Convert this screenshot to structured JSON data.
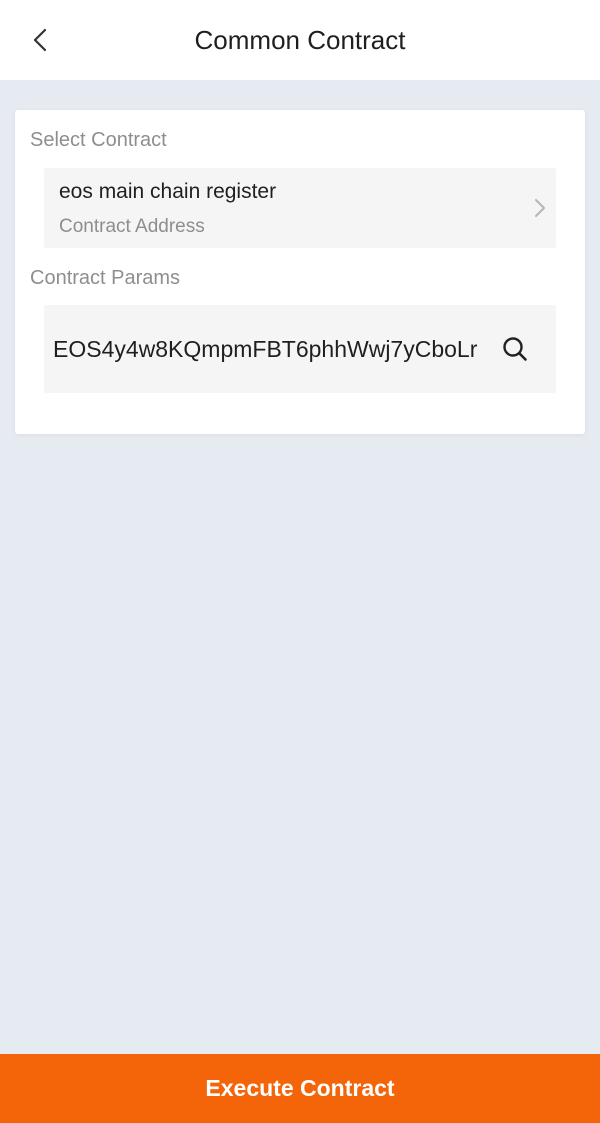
{
  "header": {
    "title": "Common Contract",
    "back_icon": "chevron-left-icon"
  },
  "select_contract": {
    "label": "Select Contract",
    "contract_name": "eos main chain register",
    "contract_address_placeholder": "Contract Address",
    "chevron_icon": "chevron-right-icon"
  },
  "contract_params": {
    "label": "Contract Params",
    "value": "EOS4y4w8KQmpmFBT6phhWwj7yCboLr",
    "search_icon": "search-icon"
  },
  "footer": {
    "execute_label": "Execute Contract"
  },
  "colors": {
    "accent": "#f4650a",
    "page_background": "#e6eaf1",
    "card_background": "#ffffff",
    "field_background": "#f5f5f5",
    "primary_text": "#1f1f1f",
    "secondary_text": "#8e8e8e"
  }
}
